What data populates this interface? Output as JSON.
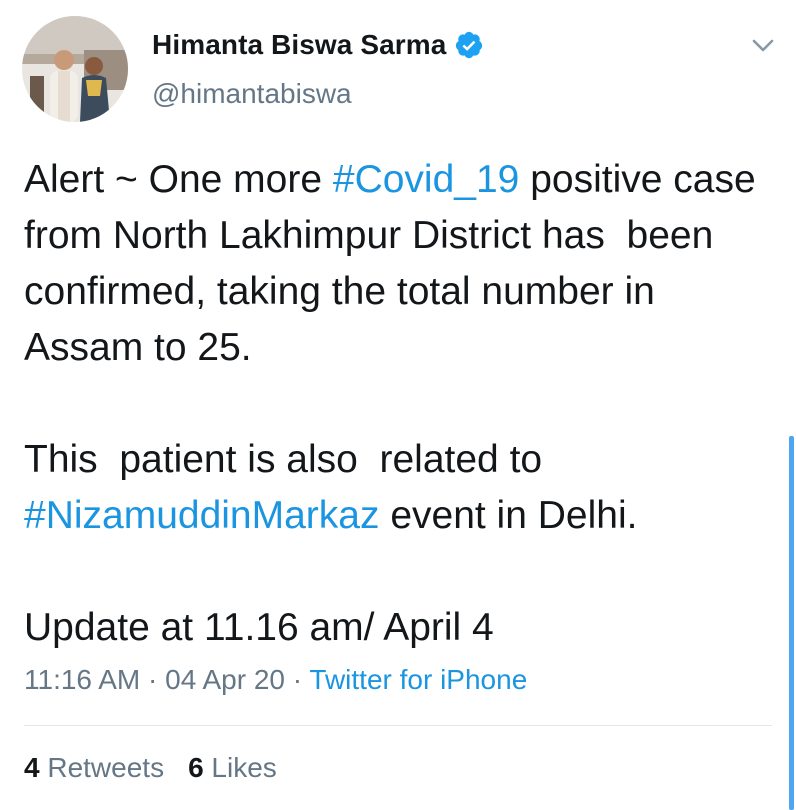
{
  "author": {
    "display_name": "Himanta Biswa Sarma",
    "handle": "@himantabiswa",
    "avatar_icon": "profile-photo",
    "verified_icon": "verified-badge-icon",
    "verified_color": "#1da1f2"
  },
  "tweet": {
    "p1_a": "Alert ~ One more ",
    "p1_hashtag": "#Covid_19",
    "p1_b": " positive case from North Lakhimpur District has  been confirmed, taking the total number in Assam to 25.",
    "p2_a": "This  patient is also  related to ",
    "p2_hashtag": "#NizamuddinMarkaz",
    "p2_b": " event in Delhi.",
    "p3": "Update at 11.16 am/ April 4"
  },
  "meta": {
    "time": "11:16 AM",
    "sep1": " · ",
    "date": "04 Apr 20",
    "sep2": " · ",
    "source": "Twitter for iPhone"
  },
  "stats": {
    "retweets_count": "4",
    "retweets_label": " Retweets",
    "likes_count": "6",
    "likes_label": " Likes"
  },
  "colors": {
    "link": "#1b95e0",
    "secondary_text": "#657786",
    "primary_text": "#14171a",
    "divider": "#e1e8ed",
    "scrollbar": "#4ea5f0"
  },
  "icons": {
    "menu": "chevron-down-icon"
  }
}
